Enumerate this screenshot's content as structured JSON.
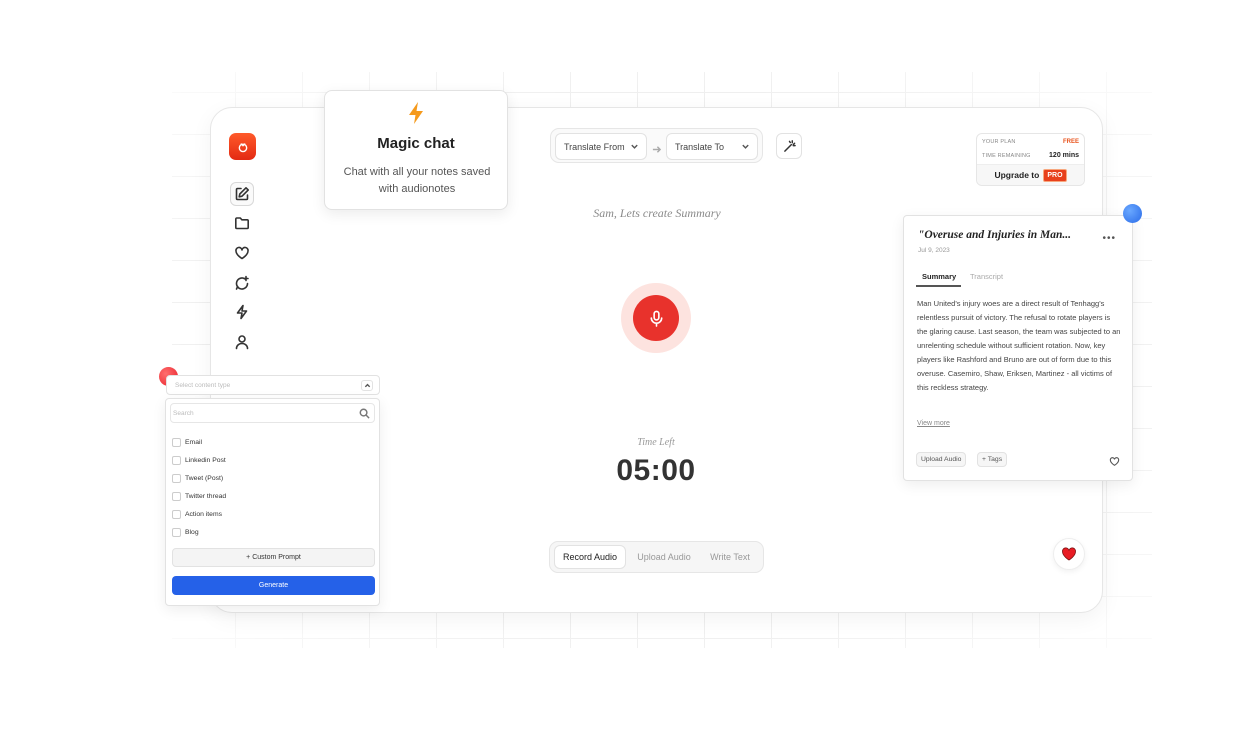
{
  "magic_chat": {
    "title": "Magic chat",
    "description": "Chat with all your notes saved with audionotes"
  },
  "translate": {
    "from_label": "Translate From",
    "to_label": "Translate To"
  },
  "plan": {
    "plan_label": "YOUR PLAN",
    "plan_value": "FREE",
    "time_label": "TIME REMAINING",
    "time_value": "120 mins",
    "upgrade_label": "Upgrade to",
    "pro_badge": "PRO"
  },
  "greeting": "Sam, Lets create Summary",
  "recorder": {
    "time_left_label": "Time Left",
    "timer": "05:00"
  },
  "modes": [
    {
      "label": "Record Audio",
      "active": true
    },
    {
      "label": "Upload Audio",
      "active": false
    },
    {
      "label": "Write Text",
      "active": false
    }
  ],
  "summary_card": {
    "title": "\"Overuse and Injuries in Man...",
    "date": "Jul 9, 2023",
    "more_icon": "more-dots-icon",
    "tabs": [
      {
        "label": "Summary",
        "active": true
      },
      {
        "label": "Transcript",
        "active": false
      }
    ],
    "body": "Man United's injury woes are a direct result of Tenhagg's relentless pursuit of victory. The refusal to rotate players is the glaring cause. Last season, the team was subjected to an unrelenting schedule without sufficient rotation. Now, key players like Rashford and Bruno are out of form due to this overuse. Casemiro, Shaw, Eriksen, Martinez - all victims of this reckless strategy.",
    "view_more": "View more",
    "chip_upload": "Upload Audio",
    "chip_tags": "+ Tags"
  },
  "content_type": {
    "placeholder": "Select content type",
    "search_placeholder": "Search",
    "items": [
      "Email",
      "Linkedin Post",
      "Tweet (Post)",
      "Twitter thread",
      "Action items",
      "Blog"
    ],
    "custom_prompt": "+ Custom Prompt",
    "generate": "Generate"
  },
  "sidebar": {
    "icons": [
      "edit-icon",
      "folder-icon",
      "heart-icon",
      "chat-plus-icon",
      "bolt-icon",
      "user-icon"
    ]
  },
  "colors": {
    "brand": "#e8322c",
    "primary": "#2561e8",
    "accent_orange": "#f59a1d"
  }
}
